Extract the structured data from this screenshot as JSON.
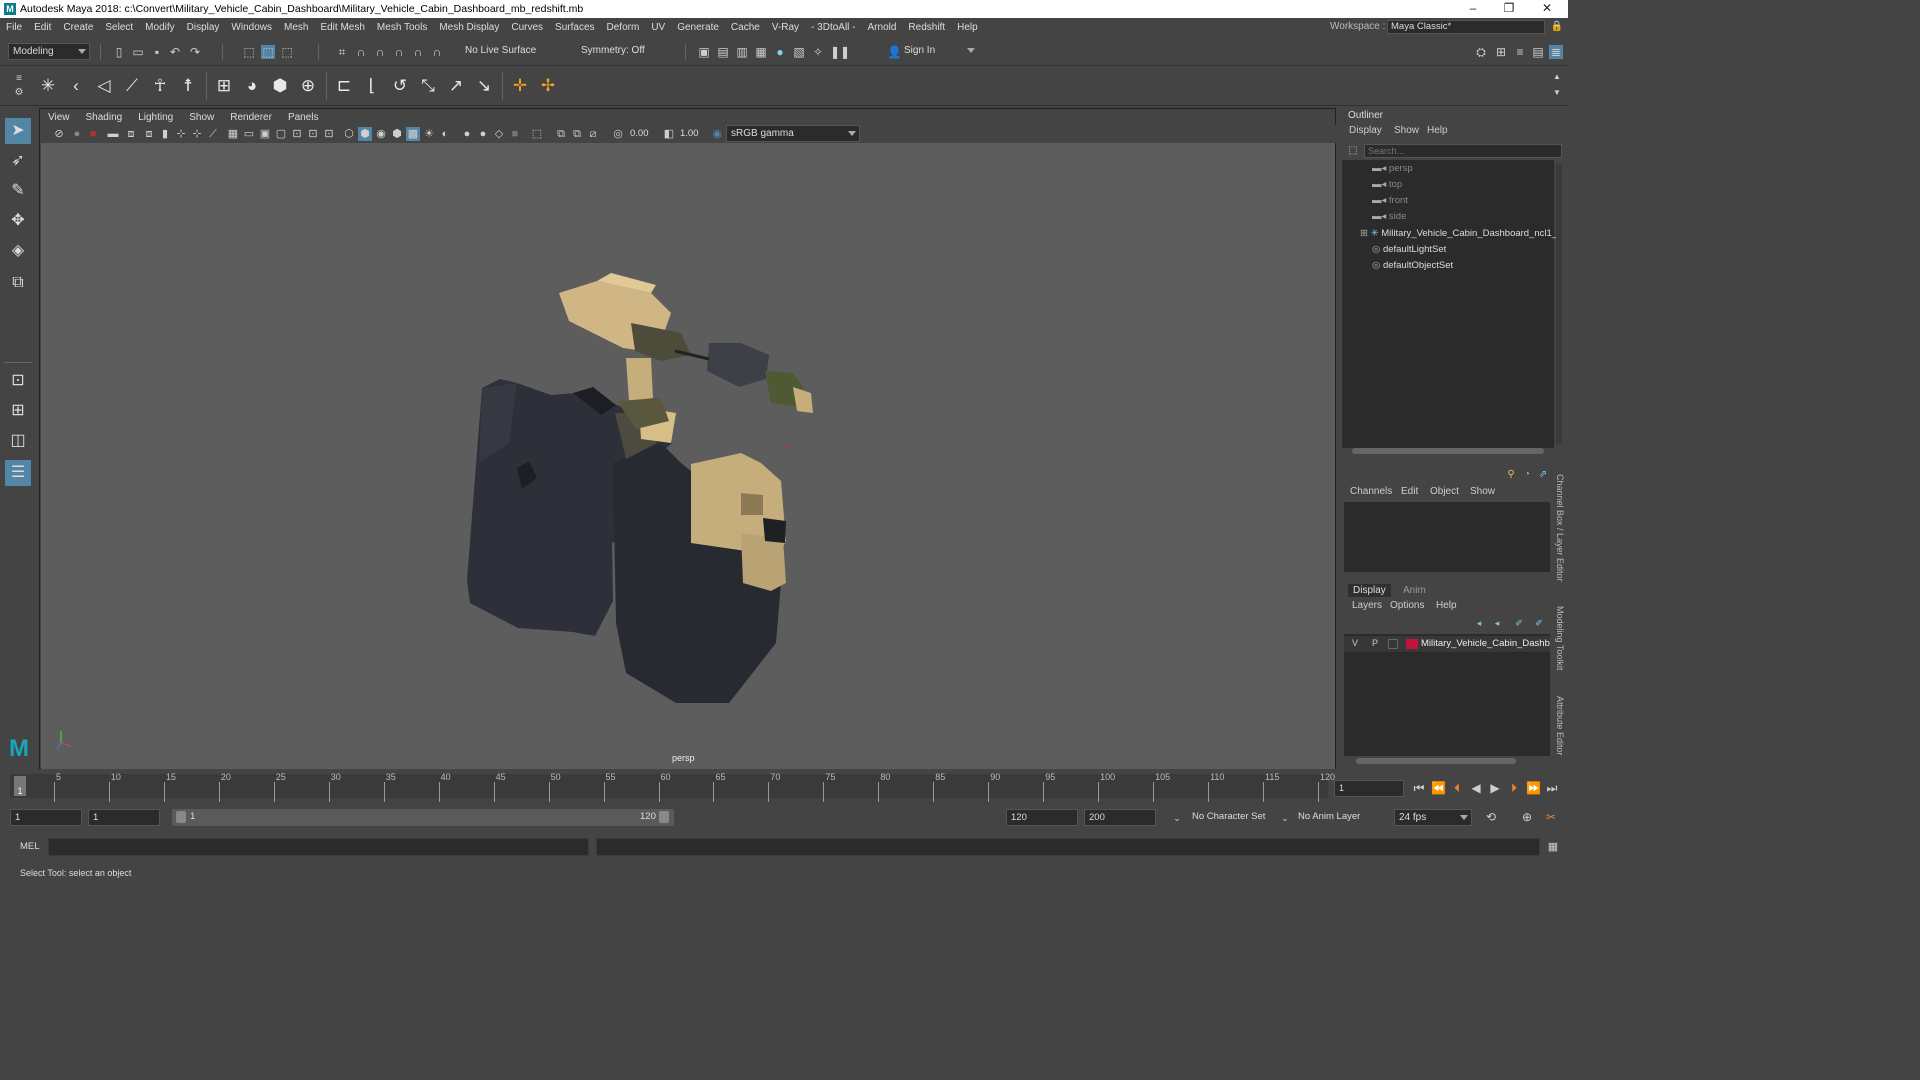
{
  "title_bar": {
    "title": "Autodesk Maya 2018: c:\\Convert\\Military_Vehicle_Cabin_Dashboard\\Military_Vehicle_Cabin_Dashboard_mb_redshift.mb",
    "minimize": "–",
    "maximize": "❐",
    "close": "✕"
  },
  "menu": [
    "File",
    "Edit",
    "Create",
    "Select",
    "Modify",
    "Display",
    "Windows",
    "Mesh",
    "Edit Mesh",
    "Mesh Tools",
    "Mesh Display",
    "Curves",
    "Surfaces",
    "Deform",
    "UV",
    "Generate",
    "Cache",
    "V-Ray",
    "- 3DtoAll -",
    "Arnold",
    "Redshift",
    "Help"
  ],
  "workspace": {
    "label": "Workspace :",
    "value": "Maya Classic*"
  },
  "toolbar": {
    "mode": "Modeling",
    "live_surface": "No Live Surface",
    "symmetry": "Symmetry: Off",
    "sign_in": "Sign In"
  },
  "panel_menu": [
    "View",
    "Shading",
    "Lighting",
    "Show",
    "Renderer",
    "Panels"
  ],
  "panel_toolbar": {
    "exposure": "0.00",
    "gamma": "1.00",
    "color_space": "sRGB gamma"
  },
  "viewport": {
    "camera_label": "persp"
  },
  "outliner": {
    "title": "Outliner",
    "menu": [
      "Display",
      "Show",
      "Help"
    ],
    "search_placeholder": "Search...",
    "items": [
      {
        "label": "persp",
        "dim": true,
        "icon": "camera-icon"
      },
      {
        "label": "top",
        "dim": true,
        "icon": "camera-icon"
      },
      {
        "label": "front",
        "dim": true,
        "icon": "camera-icon"
      },
      {
        "label": "side",
        "dim": true,
        "icon": "camera-icon"
      },
      {
        "label": "Military_Vehicle_Cabin_Dashboard_ncl1_",
        "dim": false,
        "icon": "transform-icon"
      },
      {
        "label": "defaultLightSet",
        "dim": false,
        "icon": "set-icon"
      },
      {
        "label": "defaultObjectSet",
        "dim": false,
        "icon": "set-icon"
      }
    ]
  },
  "channel_box": {
    "menu": [
      "Channels",
      "Edit",
      "Object",
      "Show"
    ]
  },
  "layer_editor": {
    "tabs": [
      "Display",
      "Anim"
    ],
    "menu": [
      "Layers",
      "Options",
      "Help"
    ],
    "layer": {
      "v": "V",
      "p": "P",
      "name": "Military_Vehicle_Cabin_Dashb",
      "color": "#c0143c"
    }
  },
  "side_tabs": [
    "Channel Box / Layer Editor",
    "Modeling Toolkit",
    "Attribute Editor"
  ],
  "timeline": {
    "ticks": [
      5,
      10,
      15,
      20,
      25,
      30,
      35,
      40,
      45,
      50,
      55,
      60,
      65,
      70,
      75,
      80,
      85,
      90,
      95,
      100,
      105,
      110,
      115,
      120
    ],
    "current_frame": "1",
    "frame_field": "1"
  },
  "range": {
    "start": "1",
    "playback_start": "1",
    "slider_start": "1",
    "slider_end": "120",
    "playback_end": "120",
    "end": "200",
    "character_set": "No Character Set",
    "anim_layer": "No Anim Layer",
    "fps": "24 fps"
  },
  "command_line": {
    "label": "MEL"
  },
  "status": {
    "text": "Select Tool: select an object"
  },
  "colors": {
    "accent": "#5285a6",
    "model_dark": "#2a2c33",
    "model_tan": "#c9ad7b"
  }
}
